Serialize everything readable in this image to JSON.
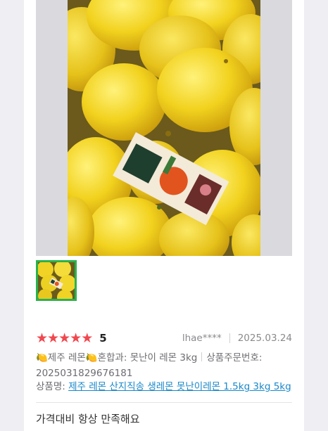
{
  "review": {
    "rating_stars": 5,
    "score": "5",
    "author": "lhae****",
    "date": "2025.03.24",
    "option_text": "🍋제주 레몬🍋혼합과: 못난이 레몬 3kg",
    "order_label": "상품주문번호:",
    "order_number": "2025031829676181",
    "product_label": "상품명:",
    "product_name": "제주 레몬 산지직송 생레몬 못난이레몬 1.5kg 3kg 5kg",
    "body": "가격대비 항상 만족해요"
  },
  "colors": {
    "star": "#f0484f",
    "thumb_border": "#2bb24c",
    "link": "#1a88c9"
  },
  "media": {
    "main_photo": "lemons-photo",
    "thumbnail": "lemons-thumbnail"
  }
}
